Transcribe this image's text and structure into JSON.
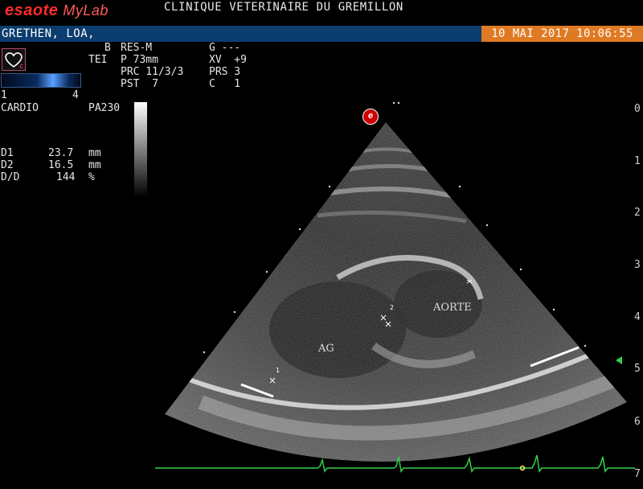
{
  "header": {
    "brand_esaote": "esaote",
    "brand_mylab": "MyLab",
    "clinic_name": "CLINIQUE VETERINAIRE DU GREMILLON",
    "patient_name": "GRETHEN, LOA,",
    "datetime": "10 MAI 2017 10:06:55"
  },
  "colors": {
    "patient_bar": "#0b3d6e",
    "datetime_bg": "#e07a22",
    "brand": "#ff2b2b",
    "ecg_trace": "#32d24a"
  },
  "params": {
    "mode": "B",
    "probe_mode": "TEI",
    "res": "RES-M",
    "p": "P 73mm",
    "prc": "PRC 11/3/3",
    "pst": "PST  7",
    "g": "G ---",
    "xv": "XV  +9",
    "prs": "PRS 3",
    "c": "C   1"
  },
  "scale": {
    "left": "1",
    "right": "4"
  },
  "preset": {
    "app": "CARDIO",
    "probe": "PA230"
  },
  "measurements": [
    {
      "label": "D1",
      "value": "23.7",
      "unit": "mm"
    },
    {
      "label": "D2",
      "value": "16.5",
      "unit": "mm"
    },
    {
      "label": "D/D",
      "value": "144",
      "unit": "%"
    }
  ],
  "depth_ruler": [
    "0",
    "1",
    "2",
    "3",
    "4",
    "5",
    "6",
    "7"
  ],
  "annotations": {
    "ag": "AG",
    "aorte": "AORTE",
    "marker1": "1",
    "marker2": "2",
    "probe_dot": "e"
  },
  "icons": {
    "heart": "heart-icon",
    "probe_orientation": "probe-orientation-icon",
    "focus_marker": "focus-arrow-icon"
  }
}
